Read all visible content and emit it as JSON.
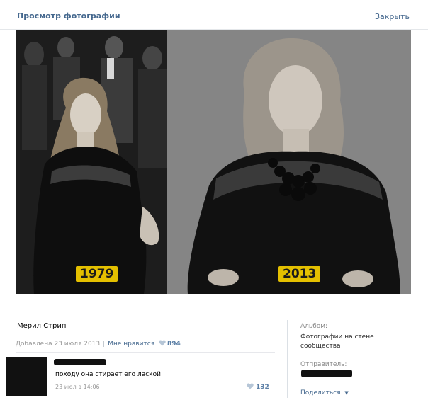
{
  "header": {
    "title": "Просмотр фотографии",
    "close_label": "Закрыть"
  },
  "photo": {
    "left_year": "1979",
    "right_year": "2013"
  },
  "info": {
    "title": "Мерил Стрип",
    "added": "Добавлена 23 июля 2013",
    "separator": "|",
    "like_label": "Мне нравится",
    "like_count": "894",
    "heart_icon": "heart-icon"
  },
  "comment": {
    "text": "походу она стирает его лаской",
    "time": "23 июл в 14:06",
    "likes": "132"
  },
  "sidebar": {
    "album_label": "Альбом:",
    "album_value": "Фотографии на стене сообщества",
    "sender_label": "Отправитель:",
    "share_label": "Поделиться",
    "share_icon": "caret-down-icon"
  },
  "colors": {
    "link": "#45688e",
    "year_badge": "#e4c000",
    "count": "#5b7fa6"
  }
}
